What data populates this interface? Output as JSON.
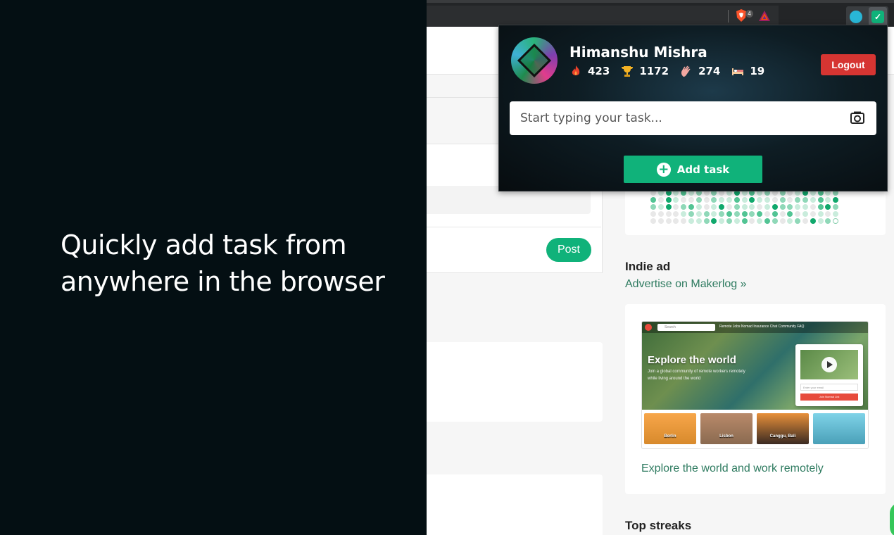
{
  "promo": {
    "line1": "Quickly add task from",
    "line2": "anywhere in the browser"
  },
  "toolbar": {
    "brave_badge": "4"
  },
  "page": {
    "post_label": "Post",
    "indie_ad_title": "Indie ad",
    "indie_ad_link": "Advertise on Makerlog »",
    "ad_caption": "Explore the world and work remotely",
    "top_streaks_title": "Top streaks",
    "ad": {
      "search_placeholder": "Search",
      "nav": "Remote Jobs   Nomad Insurance   Chat   Community   FAQ",
      "headline": "Explore the world",
      "subline": "Join a global community of remote workers remotely while living around the world",
      "email_placeholder": "Enter your email",
      "join_label": "Join Nomad List",
      "cities": [
        "Berlin",
        "Lisbon",
        "Canggu, Bali",
        ""
      ]
    }
  },
  "popup": {
    "user_name": "Himanshu Mishra",
    "stats": [
      {
        "icon": "flame-icon",
        "value": "423"
      },
      {
        "icon": "trophy-icon",
        "value": "1172"
      },
      {
        "icon": "clap-icon",
        "value": "274"
      },
      {
        "icon": "bed-icon",
        "value": "19"
      }
    ],
    "logout_label": "Logout",
    "task_placeholder": "Start typing your task...",
    "add_task_label": "Add task"
  },
  "colors": {
    "accent_green": "#10b27a",
    "logout_red": "#d63532",
    "link_green": "#2d7a5f",
    "promo_bg": "#040f13"
  }
}
